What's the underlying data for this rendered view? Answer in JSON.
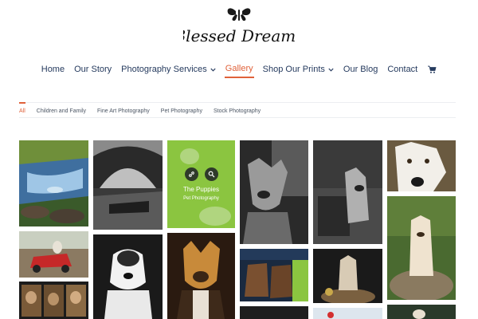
{
  "brand": {
    "logo_text": "Blessed Dreams"
  },
  "nav": {
    "items": [
      {
        "label": "Home",
        "dropdown": false,
        "active": false
      },
      {
        "label": "Our Story",
        "dropdown": false,
        "active": false
      },
      {
        "label": "Photography Services",
        "dropdown": true,
        "active": false
      },
      {
        "label": "Gallery",
        "dropdown": false,
        "active": true
      },
      {
        "label": "Shop Our Prints",
        "dropdown": true,
        "active": false
      },
      {
        "label": "Our Blog",
        "dropdown": false,
        "active": false
      },
      {
        "label": "Contact",
        "dropdown": false,
        "active": false
      }
    ],
    "cart_icon": "cart-icon"
  },
  "filters": {
    "items": [
      "All",
      "Children and Family",
      "Fine Art Photography",
      "Pet Photography",
      "Stock Photography"
    ],
    "active": "All"
  },
  "gallery": {
    "hover_item": {
      "title": "The Puppies",
      "category": "Pet Photography",
      "icons": [
        "link-icon",
        "search-icon"
      ],
      "overlay_color": "#8bc540"
    },
    "tiles": [
      "waterfall-photo",
      "red-toy-car-dog-photo",
      "pet-collage-photo",
      "stone-bridge-bw-photo",
      "white-boxer-dog-photo",
      "the-puppies-photo",
      "pitbull-puppy-photo",
      "dog-bw-portrait-photo",
      "boots-legs-photo",
      "dark-photo-bottom",
      "dog-sitting-bw-photo",
      "pup-on-rock-photo",
      "bottom-photo-col5",
      "white-dog-closeup-photo",
      "pup-standing-grass-photo",
      "bottom-photo-col6"
    ]
  },
  "colors": {
    "accent": "#e0613a",
    "nav_text": "#253a5e",
    "overlay": "#8bc540"
  }
}
